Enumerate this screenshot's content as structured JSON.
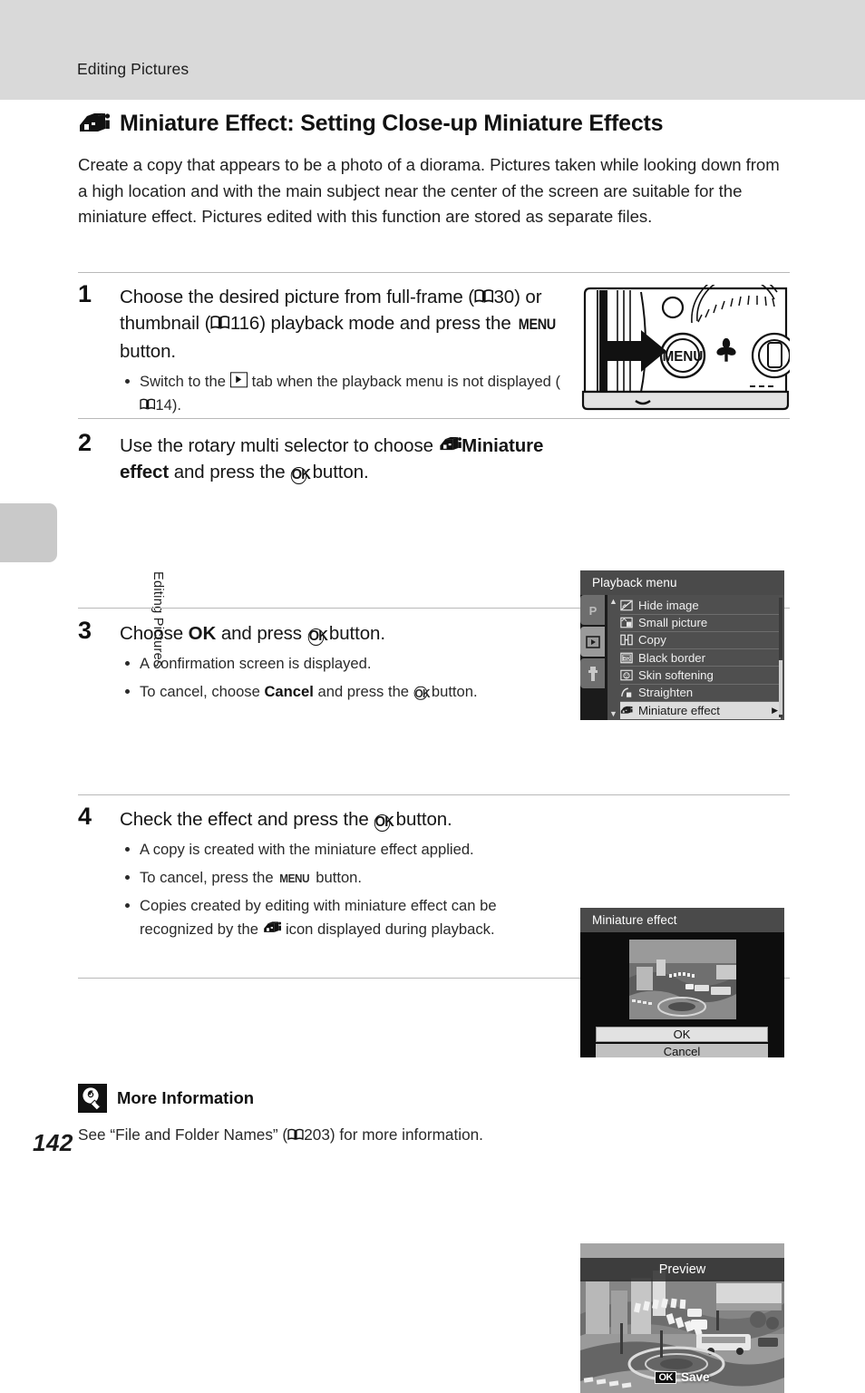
{
  "header": {
    "running_head": "Editing Pictures"
  },
  "sidebar": {
    "chapter_label": "Editing Pictures"
  },
  "page": {
    "number": "142"
  },
  "title": {
    "icon": "miniature-effect-icon",
    "text": "Miniature Effect: Setting Close-up Miniature Effects"
  },
  "intro": {
    "paragraph": "Create a copy that appears to be a photo of a diorama. Pictures taken while looking down from a high location and with the main subject near the center of the screen are suitable for the miniature effect. Pictures edited with this function are stored as separate files."
  },
  "steps": [
    {
      "number": "1",
      "head_parts": [
        {
          "t": "text",
          "v": "Choose the desired picture from full-frame ("
        },
        {
          "t": "book",
          "v": ""
        },
        {
          "t": "text",
          "v": "30) or thumbnail ("
        },
        {
          "t": "book",
          "v": ""
        },
        {
          "t": "text",
          "v": "116) playback mode and press the "
        },
        {
          "t": "menu",
          "v": "MENU"
        },
        {
          "t": "text",
          "v": " button."
        }
      ],
      "bullets": [
        {
          "parts": [
            {
              "t": "text",
              "v": "Switch to the "
            },
            {
              "t": "play",
              "v": ""
            },
            {
              "t": "text",
              "v": " tab when the playback menu is not displayed ("
            },
            {
              "t": "book",
              "v": ""
            },
            {
              "t": "text",
              "v": "14)."
            }
          ]
        }
      ]
    },
    {
      "number": "2",
      "head_parts": [
        {
          "t": "text",
          "v": "Use the rotary multi selector to choose "
        },
        {
          "t": "mini",
          "v": ""
        },
        {
          "t": "bold",
          "v": "Miniature effect"
        },
        {
          "t": "text",
          "v": " and press the "
        },
        {
          "t": "ok",
          "v": "OK"
        },
        {
          "t": "text",
          "v": " button."
        }
      ],
      "bullets": []
    },
    {
      "number": "3",
      "head_parts": [
        {
          "t": "text",
          "v": "Choose "
        },
        {
          "t": "bold",
          "v": "OK"
        },
        {
          "t": "text",
          "v": " and press "
        },
        {
          "t": "ok",
          "v": "OK"
        },
        {
          "t": "text",
          "v": " button."
        }
      ],
      "bullets": [
        {
          "parts": [
            {
              "t": "text",
              "v": "A confirmation screen is displayed."
            }
          ]
        },
        {
          "parts": [
            {
              "t": "text",
              "v": "To cancel, choose "
            },
            {
              "t": "bold",
              "v": "Cancel"
            },
            {
              "t": "text",
              "v": " and press the "
            },
            {
              "t": "ok",
              "v": "OK"
            },
            {
              "t": "text",
              "v": " button."
            }
          ]
        }
      ]
    },
    {
      "number": "4",
      "head_parts": [
        {
          "t": "text",
          "v": "Check the effect and press the "
        },
        {
          "t": "ok",
          "v": "OK"
        },
        {
          "t": "text",
          "v": " button."
        }
      ],
      "bullets": [
        {
          "parts": [
            {
              "t": "text",
              "v": "A copy is created with the miniature effect applied."
            }
          ]
        },
        {
          "parts": [
            {
              "t": "text",
              "v": "To cancel, press the "
            },
            {
              "t": "menu",
              "v": "MENU"
            },
            {
              "t": "text",
              "v": " button."
            }
          ]
        },
        {
          "parts": [
            {
              "t": "text",
              "v": "Copies created by editing with miniature effect can be recognized by the "
            },
            {
              "t": "mini",
              "v": ""
            },
            {
              "t": "text",
              "v": " icon displayed during playback."
            }
          ]
        }
      ]
    }
  ],
  "figures": {
    "camera_illustration": {
      "button_label": "MENU",
      "macro_icon": "macro-flower-icon",
      "arrow_icon": "right-arrow-icon"
    },
    "playback_menu": {
      "title": "Playback menu",
      "tabs": [
        {
          "label": "P",
          "name": "shooting-tab",
          "active": false
        },
        {
          "label": "▶",
          "name": "playback-tab",
          "active": true
        },
        {
          "label": "Ÿ",
          "name": "setup-tab",
          "active": false
        }
      ],
      "items": [
        {
          "label": "Hide image",
          "icon": "hide-image-icon",
          "selected": false
        },
        {
          "label": "Small picture",
          "icon": "small-picture-icon",
          "selected": false
        },
        {
          "label": "Copy",
          "icon": "copy-icon",
          "selected": false
        },
        {
          "label": "Black border",
          "icon": "black-border-icon",
          "selected": false
        },
        {
          "label": "Skin softening",
          "icon": "skin-softening-icon",
          "selected": false
        },
        {
          "label": "Straighten",
          "icon": "straighten-icon",
          "selected": false
        },
        {
          "label": "Miniature effect",
          "icon": "miniature-effect-icon",
          "selected": true
        }
      ],
      "scroll_up": "▲",
      "scroll_down": "▼",
      "submenu_arrow": "▶"
    },
    "confirm_screen": {
      "title": "Miniature effect",
      "ok_label": "OK",
      "cancel_label": "Cancel"
    },
    "preview_screen": {
      "title": "Preview",
      "ok_badge": "OK",
      "save_label": "Save"
    }
  },
  "more_information": {
    "icon": "lightbulb-icon",
    "title": "More Information",
    "text_parts": [
      {
        "t": "text",
        "v": "See “File and Folder Names” ("
      },
      {
        "t": "book",
        "v": ""
      },
      {
        "t": "text",
        "v": "203) for more information."
      }
    ]
  }
}
